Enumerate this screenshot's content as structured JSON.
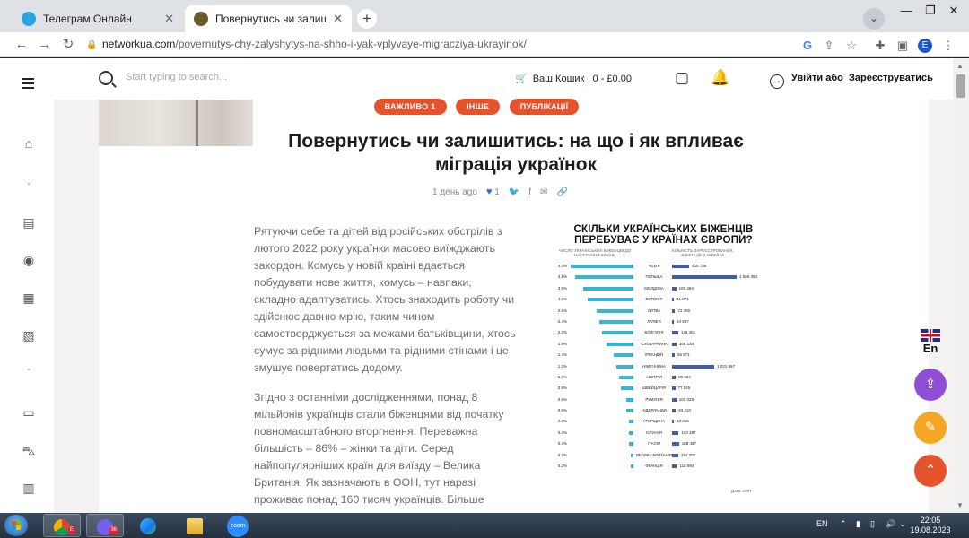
{
  "browser": {
    "tabs": [
      {
        "title": "Телеграм Онлайн",
        "favicon_color": "#2aa3e0"
      },
      {
        "title": "Повернутись чи залишитись: н",
        "favicon_color": "#6b5a2c"
      }
    ],
    "window_controls": {
      "minimize": "—",
      "restore": "❐",
      "close": "✕"
    },
    "url_host": "networkua.com",
    "url_path": "/povernutys-chy-zalyshytys-na-shho-i-yak-vplyvaye-migracziya-ukrayinok/",
    "profile_initial": "E"
  },
  "header": {
    "search_placeholder": "Start typing to search...",
    "cart_label": "Ваш Кошик",
    "cart_total": "0 - £0.00",
    "login_label": "Увійти або",
    "register_label": "Зареєструватись"
  },
  "article": {
    "tags": [
      "ВАЖЛИВО 1",
      "ІНШЕ",
      "ПУБЛІКАЦІЇ"
    ],
    "title_line1": "Повернутись чи залишитись: на що і як впливає",
    "title_line2": "міграція українок",
    "time_ago": "1 день ago",
    "likes": "1",
    "paragraph1": "Рятуючи себе та дітей від російських обстрілів з лютого 2022 року українки масово виїжджають закордон. Комусь у новій країні вдається побудувати нове життя, комусь – навпаки, складно адаптуватись. Хтось знаходить роботу чи здійснює давню мрію, таким чином самостверджується за межами батьківщини, хтось сумує за рідними людьми та рідними стінами і це змушує повертатись додому.",
    "paragraph2": "Згідно з останніми дослідженнями, понад 8 мільйонів українців стали біженцями від початку повномасштабного вторгнення. Переважна більшість – 86% – жінки та діти. Серед найпопулярніших країн для виїзду – Велика Британія. Як зазначають в ООН, тут наразі проживає понад 160 тисяч українців. Більше"
  },
  "infographic": {
    "title_line1": "СКІЛЬКИ УКРАЇНСЬКИХ БІЖЕНЦІВ",
    "title_line2": "ПЕРЕБУВАЄ У КРАЇНАХ ЄВРОПИ?",
    "left_header": "ЧИСЛО УКРАЇНСЬКИХ БІЖЕНЦІВ ДО НАСЕЛЕННЯ КРАЇНИ",
    "right_header": "КІЛЬКІСТЬ ЗАРЕЄСТРОВАНИХ БІЖЕНЦІВ З УКРАЇНИ",
    "source": "ДАНІ: ООН",
    "rows": [
      {
        "country": "ЧЕХІЯ",
        "share": "4.4%",
        "share_value": 4.4,
        "count": "415 736",
        "count_value": 415736
      },
      {
        "country": "ПОЛЬЩА",
        "share": "4.1%",
        "share_value": 4.1,
        "count": "1 566 354",
        "count_value": 1566354
      },
      {
        "country": "МОЛДОВА",
        "share": "3.5%",
        "share_value": 3.5,
        "count": "100 494",
        "count_value": 100494
      },
      {
        "country": "ЕСТОНІЯ",
        "share": "3.2%",
        "share_value": 3.2,
        "count": "41 871",
        "count_value": 41871
      },
      {
        "country": "ЛИТВА",
        "share": "2.6%",
        "share_value": 2.6,
        "count": "72 480",
        "count_value": 72480
      },
      {
        "country": "ЛАТВІЯ",
        "share": "2.4%",
        "share_value": 2.4,
        "count": "44 587",
        "count_value": 44587
      },
      {
        "country": "БОЛГАРІЯ",
        "share": "2.2%",
        "share_value": 2.2,
        "count": "148 451",
        "count_value": 148451
      },
      {
        "country": "СЛОВАЧЧИНА",
        "share": "1.9%",
        "share_value": 1.9,
        "count": "105 134",
        "count_value": 105134
      },
      {
        "country": "ІРЛАНДІЯ",
        "share": "1.4%",
        "share_value": 1.4,
        "count": "65 871",
        "count_value": 65871
      },
      {
        "country": "НІМЕЧЧИНА",
        "share": "1.2%",
        "share_value": 1.2,
        "count": "1 021 667",
        "count_value": 1021667
      },
      {
        "country": "АВСТРІЯ",
        "share": "1.0%",
        "share_value": 1.0,
        "count": "90 994",
        "count_value": 90994
      },
      {
        "country": "ШВЕЙЦАРІЯ",
        "share": "0.9%",
        "share_value": 0.9,
        "count": "77 045",
        "count_value": 77045
      },
      {
        "country": "РУМУНІЯ",
        "share": "0.5%",
        "share_value": 0.5,
        "count": "102 029",
        "count_value": 102029
      },
      {
        "country": "НІДЕРЛАНДИ",
        "share": "0.5%",
        "share_value": 0.5,
        "count": "93 210",
        "count_value": 93210
      },
      {
        "country": "УГОРЩИНА",
        "share": "0.3%",
        "share_value": 0.3,
        "count": "33 316",
        "count_value": 33316
      },
      {
        "country": "ІСПАНІЯ",
        "share": "0.3%",
        "share_value": 0.3,
        "count": "160 287",
        "count_value": 160287
      },
      {
        "country": "ІТАЛІЯ",
        "share": "0.3%",
        "share_value": 0.3,
        "count": "168 487",
        "count_value": 168487
      },
      {
        "country": "ВЕЛИКА БРИТАНІЯ",
        "share": "0.2%",
        "share_value": 0.2,
        "count": "152 200",
        "count_value": 152200
      },
      {
        "country": "ФРАНЦІЯ",
        "share": "0.2%",
        "share_value": 0.2,
        "count": "118 994",
        "count_value": 118994
      }
    ],
    "colors": {
      "share_bar": "#37b5d7",
      "count_bar": "#3f5bb3"
    }
  },
  "floating": {
    "language": "En"
  },
  "taskbar": {
    "apps": [
      {
        "name": "chrome",
        "badge": "E"
      },
      {
        "name": "viber",
        "badge": "36"
      },
      {
        "name": "edge",
        "badge": ""
      },
      {
        "name": "explorer",
        "badge": ""
      },
      {
        "name": "zoom",
        "label": "zoom"
      }
    ],
    "lang": "EN",
    "time": "22:05",
    "date": "19.08.2023"
  },
  "colors": {
    "accent": "#e5532d",
    "like": "#2d6fd8",
    "fab_share": "#8e4fd6",
    "fab_yellow": "#f5a623",
    "fab_up": "#e5532d"
  }
}
